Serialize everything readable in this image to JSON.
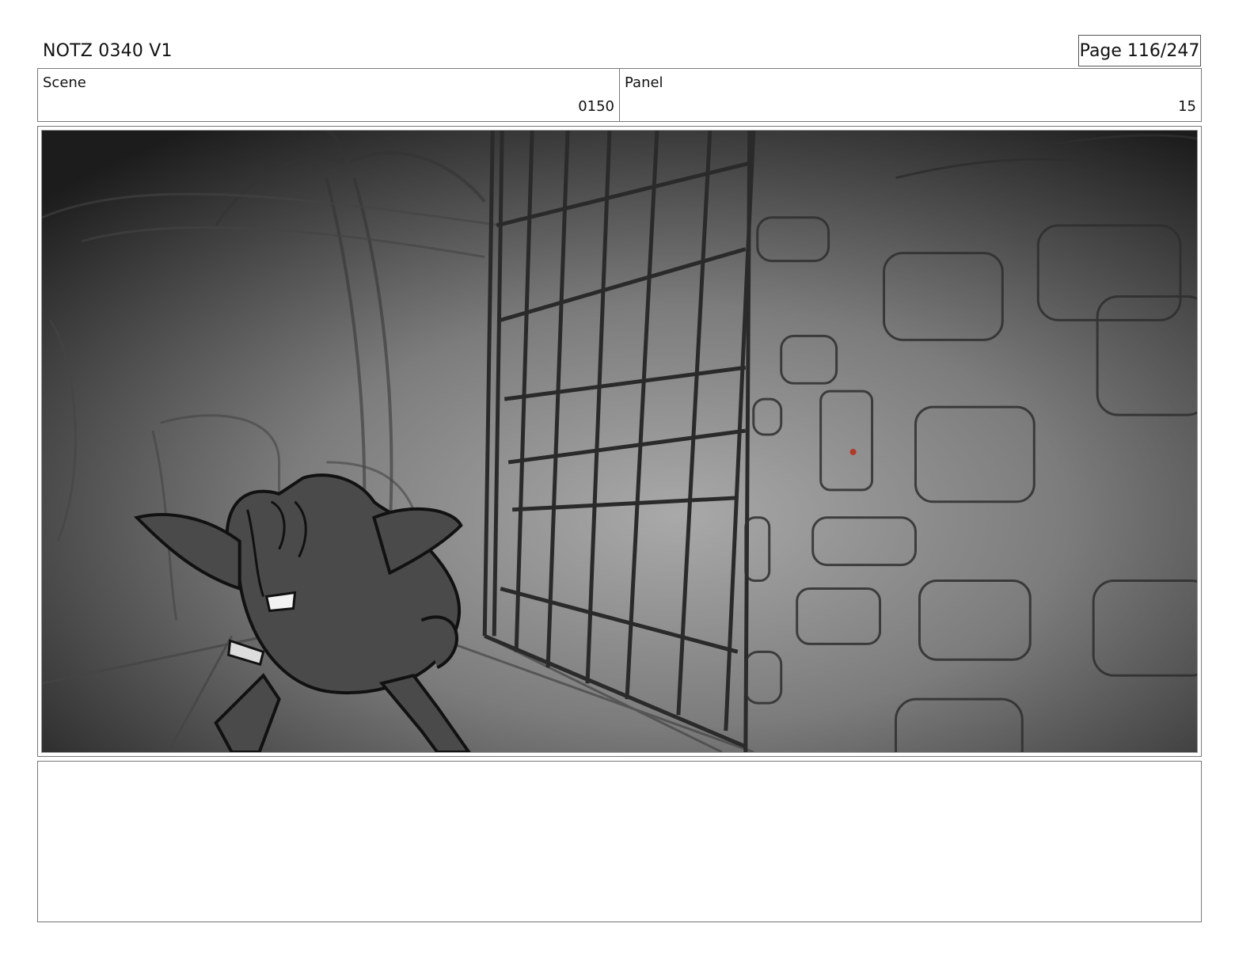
{
  "header": {
    "doc_title": "NOTZ 0340 V1",
    "page_label": "Page 116/247"
  },
  "info": {
    "scene_label": "Scene",
    "scene_value": "0150",
    "panel_label": "Panel",
    "panel_value": "15"
  },
  "notes": {
    "text": ""
  },
  "colors": {
    "sketch_dark": "#2a2a2a",
    "accent_dot": "#b23a2a"
  }
}
